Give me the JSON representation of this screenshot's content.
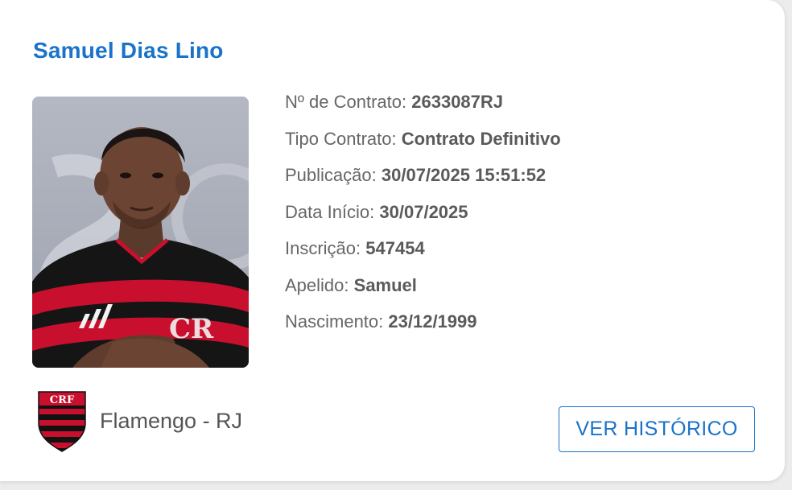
{
  "player": {
    "name": "Samuel Dias Lino"
  },
  "details": [
    {
      "label": "Nº de Contrato:",
      "value": "2633087RJ"
    },
    {
      "label": "Tipo Contrato:",
      "value": "Contrato Definitivo"
    },
    {
      "label": "Publicação:",
      "value": "30/07/2025 15:51:52"
    },
    {
      "label": "Data Início:",
      "value": "30/07/2025"
    },
    {
      "label": "Inscrição:",
      "value": "547454"
    },
    {
      "label": "Apelido:",
      "value": "Samuel"
    },
    {
      "label": "Nascimento:",
      "value": "23/12/1999"
    }
  ],
  "club": {
    "name": "Flamengo - RJ",
    "crest_icon": "flamengo-crest-icon",
    "crest_colors": [
      "#c8102e",
      "#111111"
    ]
  },
  "actions": {
    "history_label": "VER HISTÓRICO"
  },
  "colors": {
    "accent": "#1a73c9",
    "text": "#666666"
  }
}
